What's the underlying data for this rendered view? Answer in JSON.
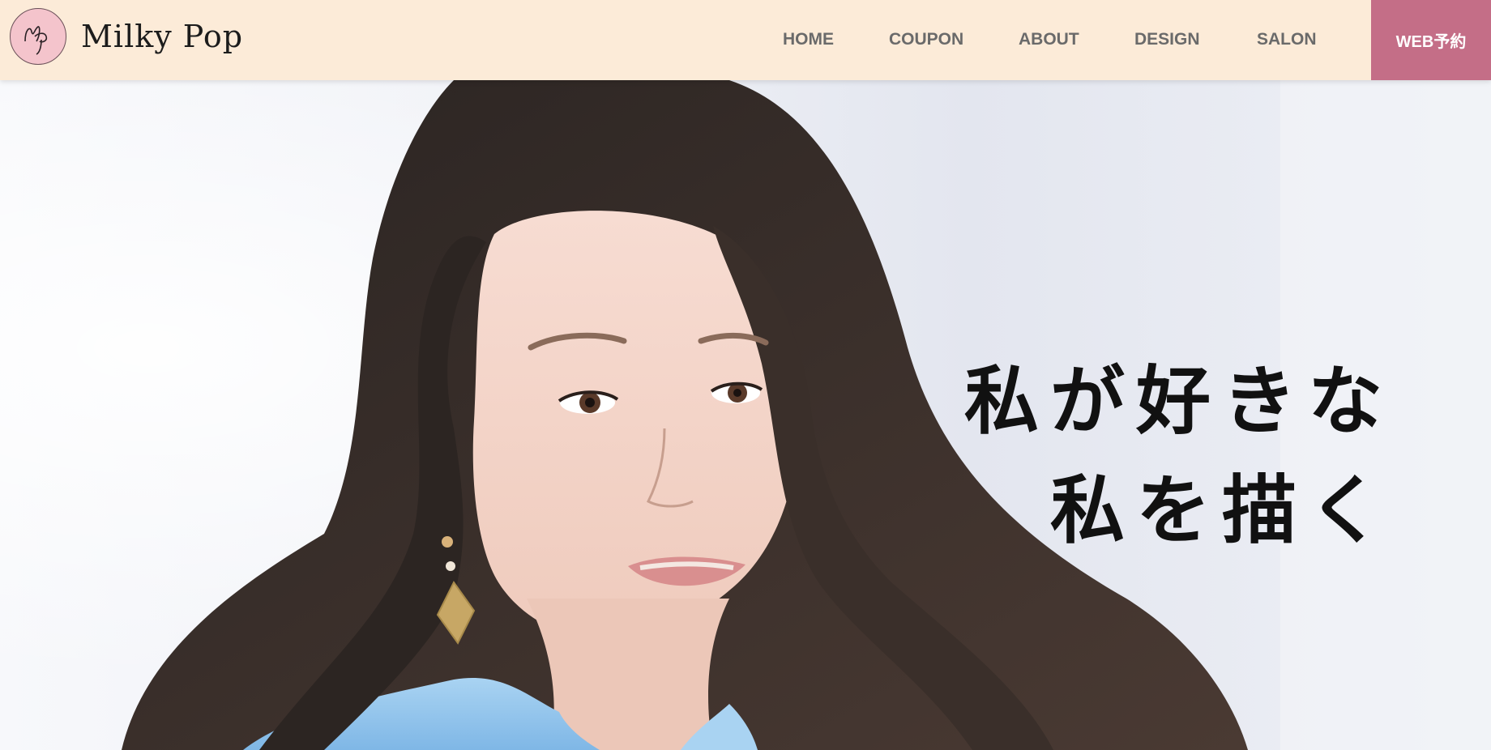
{
  "header": {
    "site_name": "Milky Pop",
    "logo_monogram": "MP",
    "nav": [
      "HOME",
      "COUPON",
      "ABOUT",
      "DESIGN",
      "SALON"
    ],
    "reserve_label": "WEB予約"
  },
  "hero": {
    "catch_line_1": "私が好きな",
    "catch_line_2": "私を描く"
  },
  "colors": {
    "header_bg": "#fcebd8",
    "reserve_bg": "#c46e87",
    "logo_bg": "#f4c4cc",
    "nav_text": "#6a6a6a"
  }
}
